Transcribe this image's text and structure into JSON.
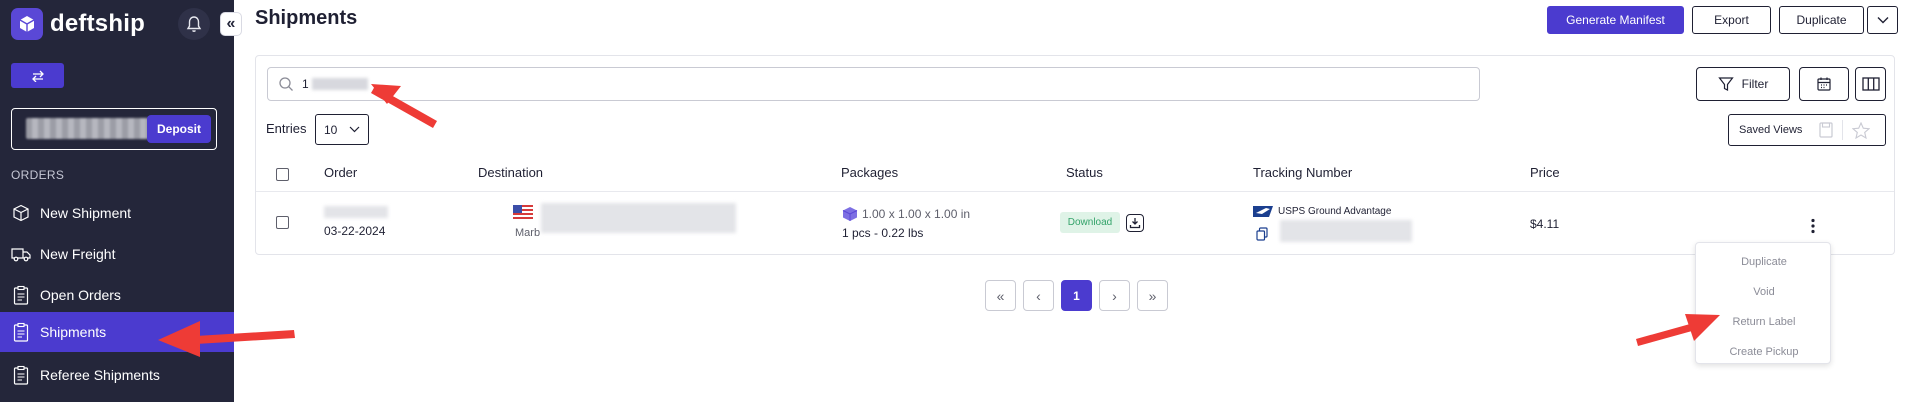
{
  "brand": {
    "name": "deftship"
  },
  "sidebar": {
    "deposit_label": "Deposit",
    "section_label": "ORDERS",
    "items": [
      {
        "label": "New Shipment",
        "icon": "box-icon"
      },
      {
        "label": "New Freight",
        "icon": "truck-icon"
      },
      {
        "label": "Open Orders",
        "icon": "clipboard-icon"
      },
      {
        "label": "Shipments",
        "icon": "clipboard-icon",
        "active": true
      },
      {
        "label": "Referee Shipments",
        "icon": "clipboard-icon"
      }
    ]
  },
  "header": {
    "title": "Shipments",
    "generate_manifest": "Generate Manifest",
    "export": "Export",
    "duplicate": "Duplicate"
  },
  "toolbar": {
    "search_value": "1",
    "filter_label": "Filter",
    "entries_label": "Entries",
    "entries_value": "10",
    "saved_views_label": "Saved Views"
  },
  "table": {
    "columns": [
      "Order",
      "Destination",
      "Packages",
      "Status",
      "Tracking Number",
      "Price"
    ],
    "rows": [
      {
        "order_date": "03-22-2024",
        "destination_city": "Marb",
        "package_dims": "1.00 x 1.00 x 1.00 in",
        "package_summary": "1 pcs - 0.22 lbs",
        "status": "Download",
        "carrier_service": "USPS Ground Advantage",
        "price": "$4.11"
      }
    ]
  },
  "row_menu": [
    "Duplicate",
    "Void",
    "Return Label",
    "Create Pickup"
  ],
  "pagination": {
    "current_page": "1"
  },
  "colors": {
    "accent": "#4b3bcf",
    "sidebar_bg": "#24263a",
    "annotation_red": "#ee3b36"
  }
}
